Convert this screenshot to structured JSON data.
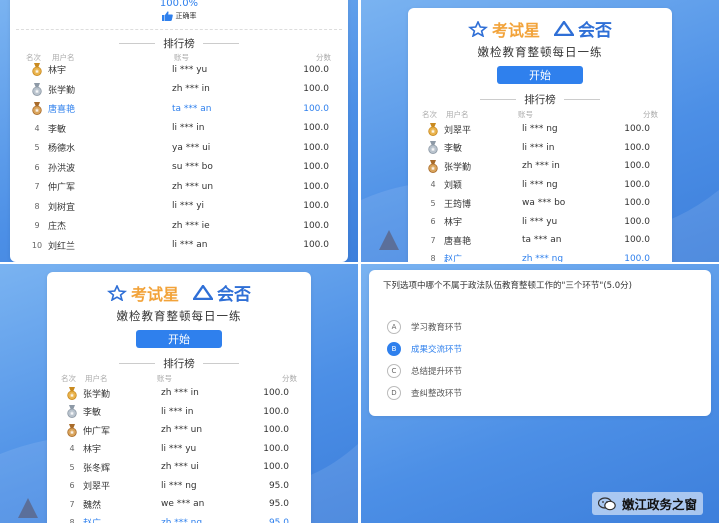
{
  "panel1": {
    "accuracy": "100.0%",
    "accuracy_label": "正确率",
    "ranking_title": "排行榜",
    "headers": {
      "rank": "名次",
      "name": "用户名",
      "account": "账号",
      "score": "分数"
    },
    "rows": [
      {
        "rank": "",
        "medal": "gold",
        "name": "林宇",
        "account": "li *** yu",
        "score": "100.0",
        "highlight": false
      },
      {
        "rank": "",
        "medal": "silver",
        "name": "张学勤",
        "account": "zh *** in",
        "score": "100.0",
        "highlight": false
      },
      {
        "rank": "",
        "medal": "bronze",
        "name": "唐喜艳",
        "account": "ta *** an",
        "score": "100.0",
        "highlight": true
      },
      {
        "rank": "4",
        "medal": "",
        "name": "李敏",
        "account": "li *** in",
        "score": "100.0",
        "highlight": false
      },
      {
        "rank": "5",
        "medal": "",
        "name": "杨德水",
        "account": "ya *** ui",
        "score": "100.0",
        "highlight": false
      },
      {
        "rank": "6",
        "medal": "",
        "name": "孙洪波",
        "account": "su *** bo",
        "score": "100.0",
        "highlight": false
      },
      {
        "rank": "7",
        "medal": "",
        "name": "仲广军",
        "account": "zh *** un",
        "score": "100.0",
        "highlight": false
      },
      {
        "rank": "8",
        "medal": "",
        "name": "刘树宜",
        "account": "li *** yi",
        "score": "100.0",
        "highlight": false
      },
      {
        "rank": "9",
        "medal": "",
        "name": "庄杰",
        "account": "zh *** ie",
        "score": "100.0",
        "highlight": false
      },
      {
        "rank": "10",
        "medal": "",
        "name": "刘红兰",
        "account": "li *** an",
        "score": "100.0",
        "highlight": false
      }
    ]
  },
  "panel2": {
    "logo_left": "考试星",
    "logo_right": "会否",
    "subtitle": "嫩检教育整顿每日一练",
    "start_label": "开始",
    "ranking_title": "排行榜",
    "headers": {
      "rank": "名次",
      "name": "用户名",
      "account": "账号",
      "score": "分数"
    },
    "rows": [
      {
        "rank": "",
        "medal": "gold",
        "name": "刘翠平",
        "account": "li *** ng",
        "score": "100.0",
        "highlight": false
      },
      {
        "rank": "",
        "medal": "silver",
        "name": "李敏",
        "account": "li *** in",
        "score": "100.0",
        "highlight": false
      },
      {
        "rank": "",
        "medal": "bronze",
        "name": "张学勤",
        "account": "zh *** in",
        "score": "100.0",
        "highlight": false
      },
      {
        "rank": "4",
        "medal": "",
        "name": "刘颖",
        "account": "li *** ng",
        "score": "100.0",
        "highlight": false
      },
      {
        "rank": "5",
        "medal": "",
        "name": "王筠博",
        "account": "wa *** bo",
        "score": "100.0",
        "highlight": false
      },
      {
        "rank": "6",
        "medal": "",
        "name": "林宇",
        "account": "li *** yu",
        "score": "100.0",
        "highlight": false
      },
      {
        "rank": "7",
        "medal": "",
        "name": "唐喜艳",
        "account": "ta *** an",
        "score": "100.0",
        "highlight": false
      },
      {
        "rank": "8",
        "medal": "",
        "name": "赵广",
        "account": "zh *** ng",
        "score": "100.0",
        "highlight": true
      }
    ]
  },
  "panel3": {
    "logo_left": "考试星",
    "logo_right": "会否",
    "subtitle": "嫩检教育整顿每日一练",
    "start_label": "开始",
    "ranking_title": "排行榜",
    "headers": {
      "rank": "名次",
      "name": "用户名",
      "account": "账号",
      "score": "分数"
    },
    "rows": [
      {
        "rank": "",
        "medal": "gold",
        "name": "张学勤",
        "account": "zh *** in",
        "score": "100.0",
        "highlight": false
      },
      {
        "rank": "",
        "medal": "silver",
        "name": "李敏",
        "account": "li *** in",
        "score": "100.0",
        "highlight": false
      },
      {
        "rank": "",
        "medal": "bronze",
        "name": "仲广军",
        "account": "zh *** un",
        "score": "100.0",
        "highlight": false
      },
      {
        "rank": "4",
        "medal": "",
        "name": "林宇",
        "account": "li *** yu",
        "score": "100.0",
        "highlight": false
      },
      {
        "rank": "5",
        "medal": "",
        "name": "张冬辉",
        "account": "zh *** ui",
        "score": "100.0",
        "highlight": false
      },
      {
        "rank": "6",
        "medal": "",
        "name": "刘翠平",
        "account": "li *** ng",
        "score": "95.0",
        "highlight": false
      },
      {
        "rank": "7",
        "medal": "",
        "name": "魏然",
        "account": "we *** an",
        "score": "95.0",
        "highlight": false
      },
      {
        "rank": "8",
        "medal": "",
        "name": "赵广",
        "account": "zh *** ng",
        "score": "95.0",
        "highlight": true
      }
    ]
  },
  "panel4": {
    "question": "下列选项中哪个不属于政法队伍教育整顿工作的\"三个环节\"(5.0分)",
    "options": [
      {
        "letter": "A",
        "text": "学习教育环节",
        "selected": false
      },
      {
        "letter": "B",
        "text": "成果交流环节",
        "selected": true
      },
      {
        "letter": "C",
        "text": "总结提升环节",
        "selected": false
      },
      {
        "letter": "D",
        "text": "查纠整改环节",
        "selected": false
      }
    ],
    "watermark": "嫩江政务之窗"
  },
  "colors": {
    "accent": "#2f80ed",
    "gold": "#f2a33a",
    "background_blue": "#4c8fe6"
  }
}
